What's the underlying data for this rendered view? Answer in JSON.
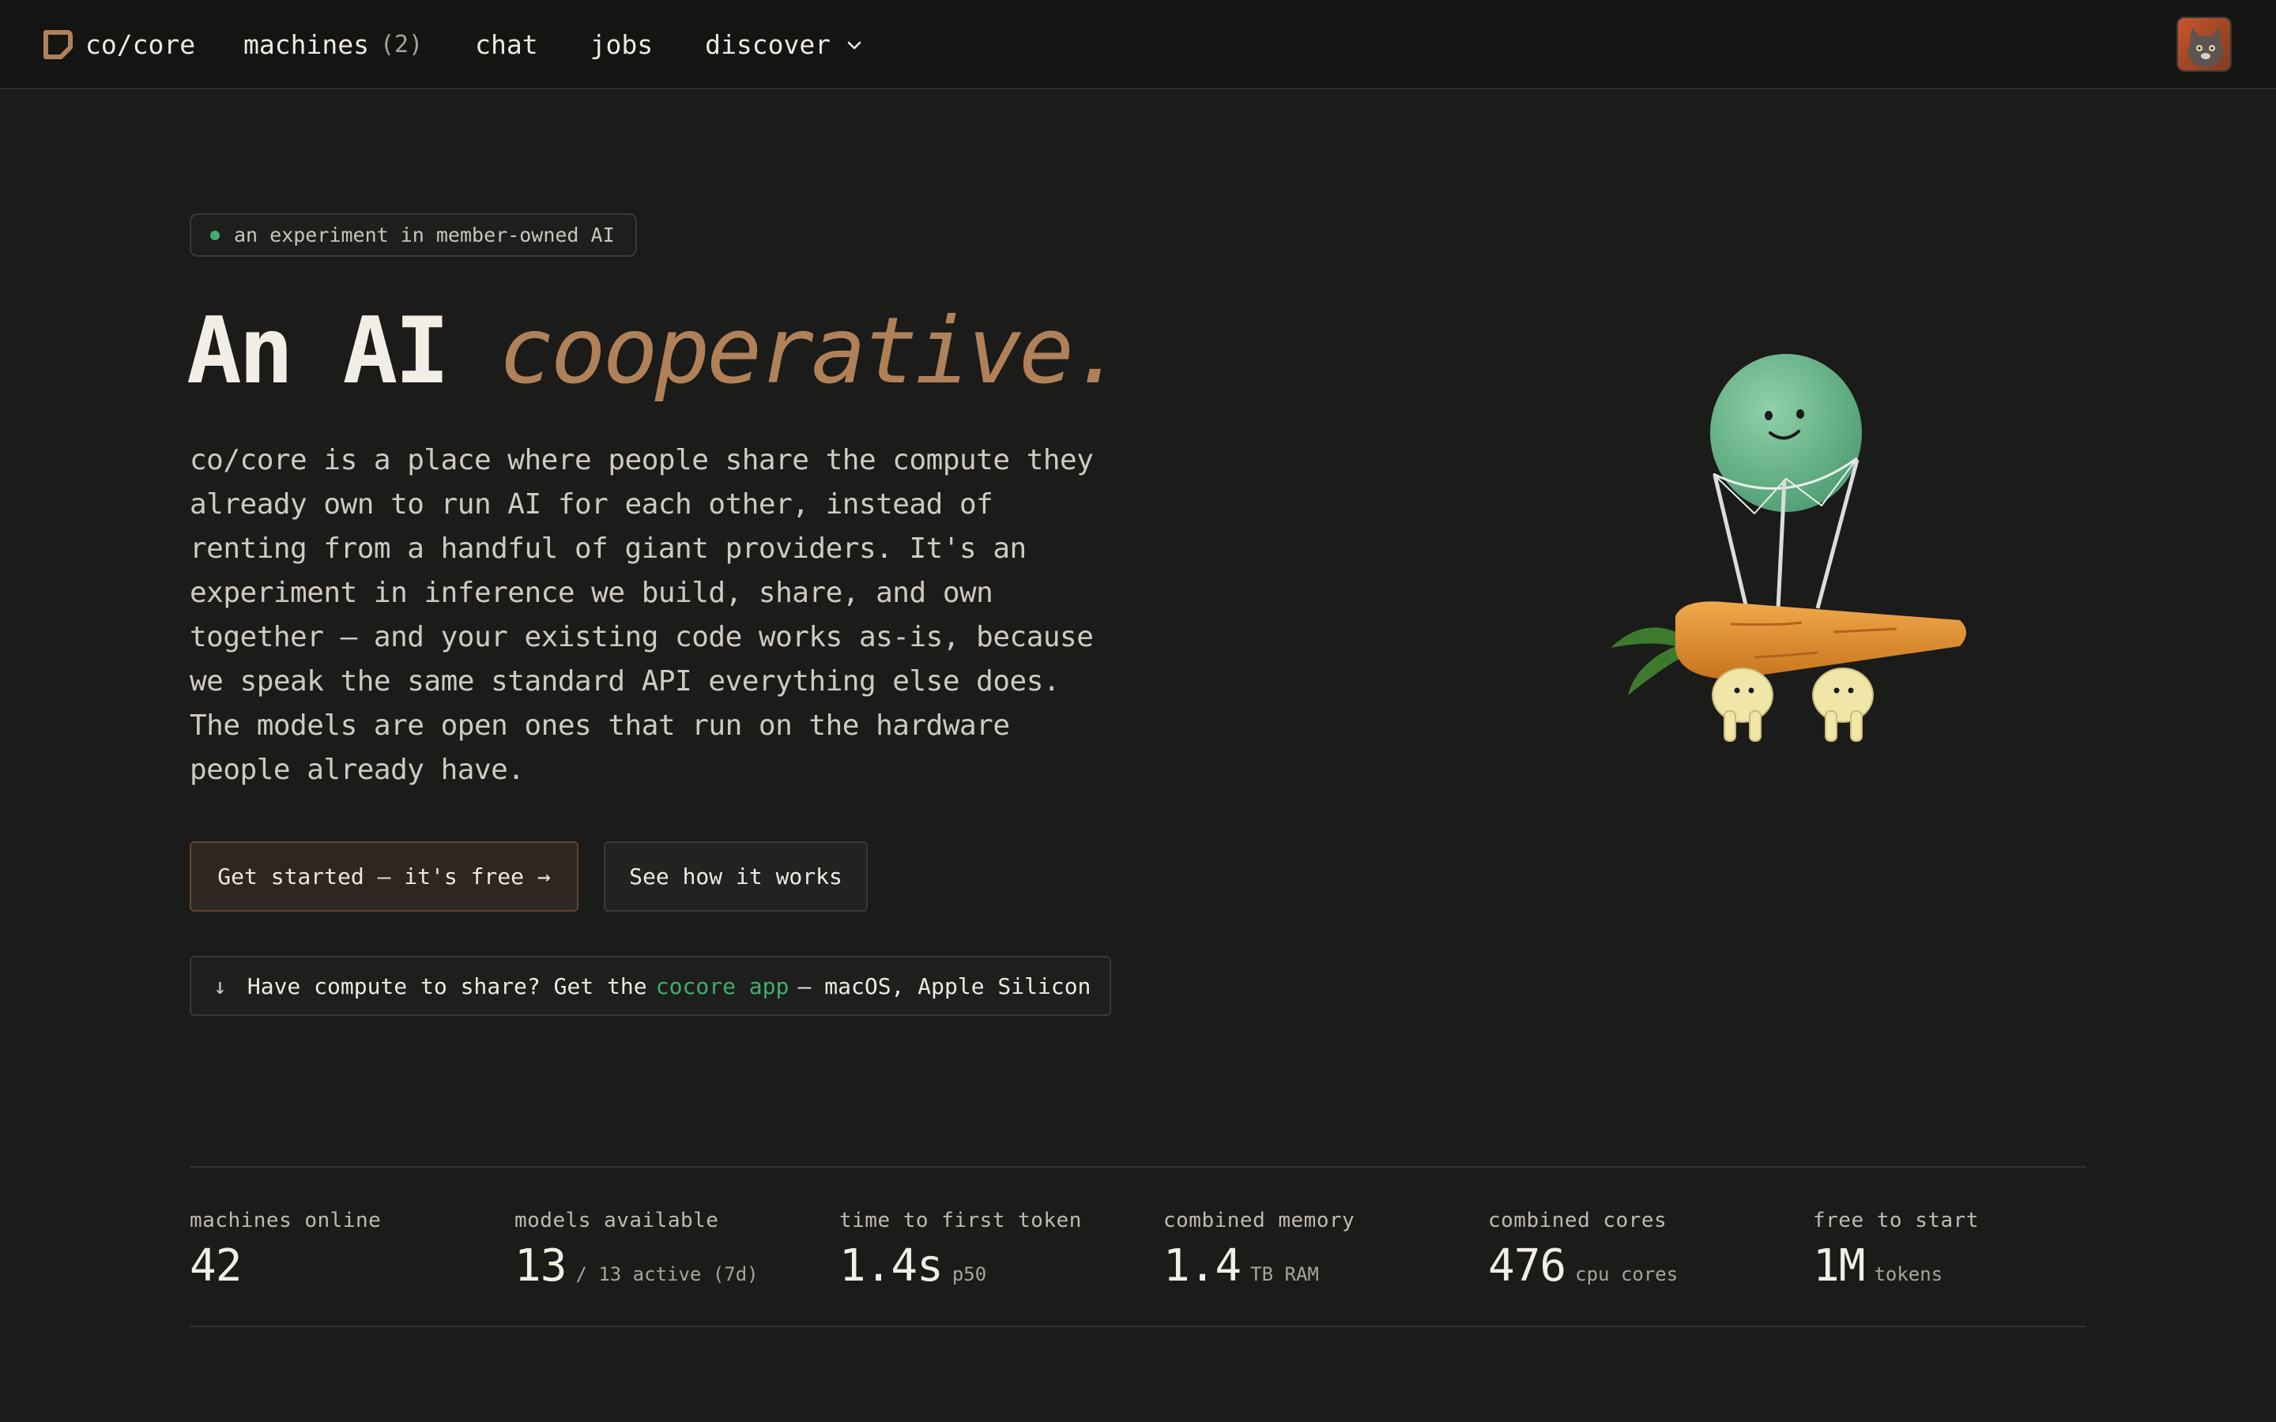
{
  "nav": {
    "brand": "co/core",
    "machines_label": "machines",
    "machines_count": "(2)",
    "chat_label": "chat",
    "jobs_label": "jobs",
    "discover_label": "discover"
  },
  "hero": {
    "badge": "an experiment in member-owned AI",
    "title_plain": "An AI",
    "title_accent": "cooperative.",
    "description": "co/core is a place where people share the compute they already own to run AI for each other, instead of renting from a handful of giant providers. It's an experiment in inference we build, share, and own together — and your existing code works as-is, because we speak the same standard API everything else does. The models are open ones that run on the hardware people already have.",
    "primary_cta": "Get started — it's free →",
    "secondary_cta": "See how it works",
    "app_banner": {
      "arrow": "↓",
      "prefix": "Have compute to share? Get the",
      "link": "cocore app",
      "suffix": "— macOS, Apple Silicon"
    }
  },
  "stats": [
    {
      "label": "machines online",
      "value": "42",
      "unit": ""
    },
    {
      "label": "models available",
      "value": "13",
      "unit": "/ 13 active (7d)"
    },
    {
      "label": "time to first token",
      "value": "1.4s",
      "unit": "p50"
    },
    {
      "label": "combined memory",
      "value": "1.4",
      "unit": "TB RAM"
    },
    {
      "label": "combined cores",
      "value": "476",
      "unit": "cpu cores"
    },
    {
      "label": "free to start",
      "value": "1M",
      "unit": "tokens"
    }
  ],
  "colors": {
    "background": "#1b1b1a",
    "nav_background": "#141413",
    "accent_copper": "#b08159",
    "accent_green": "#3fae6e",
    "text": "#eeeae2"
  },
  "icons": {
    "brand": "cocore-logo-icon",
    "discover": "chevron-down-icon",
    "avatar": "user-avatar",
    "badge": "status-dot-icon"
  }
}
